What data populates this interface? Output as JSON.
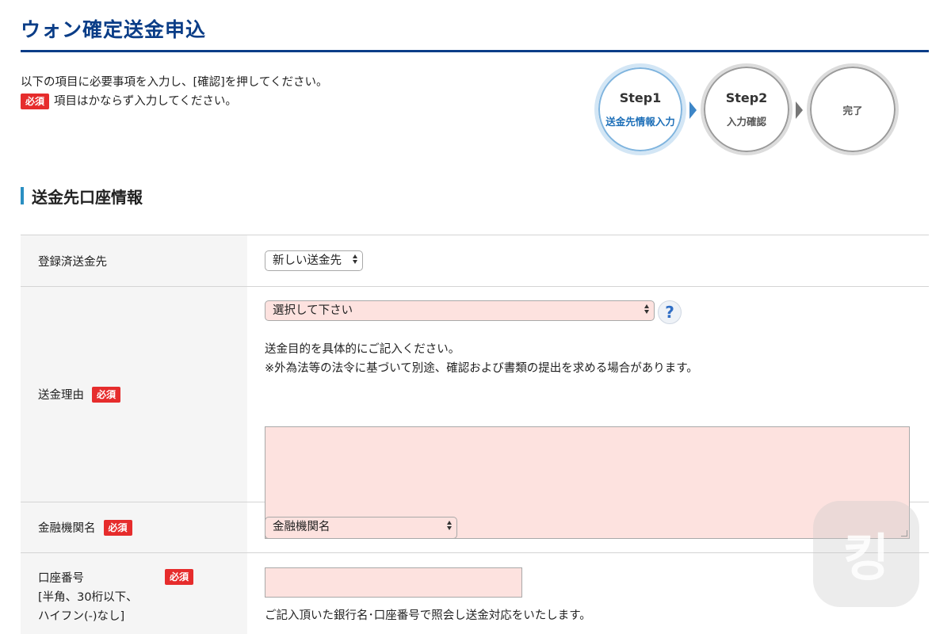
{
  "page": {
    "title": "ウォン確定送金申込"
  },
  "intro": {
    "line1": "以下の項目に必要事項を入力し、[確認]を押してください。",
    "line2": "項目はかならず入力してください。",
    "required_badge": "必須"
  },
  "steps": [
    {
      "num": "Step1",
      "label": "送金先情報入力",
      "active": true
    },
    {
      "num": "Step2",
      "label": "入力確認",
      "active": false
    },
    {
      "num": "",
      "label": "完了",
      "active": false
    }
  ],
  "section": {
    "heading": "送金先口座情報"
  },
  "form": {
    "registered": {
      "label": "登録済送金先",
      "select_value": "新しい送金先"
    },
    "reason": {
      "label": "送金理由",
      "required": "必須",
      "select_value": "選択して下さい",
      "help": "?",
      "note1": "送金目的を具体的にご記入ください。",
      "note2": "※外為法等の法令に基づいて別途、確認および書類の提出を求める場合があります。",
      "textarea_value": ""
    },
    "bank": {
      "label": "金融機関名",
      "required": "必須",
      "select_value": "金融機関名"
    },
    "account": {
      "label_line1": "口座番号",
      "label_line2": "[半角、30桁以下、",
      "label_line3": "ハイフン(-)なし]",
      "required": "必須",
      "input_value": "",
      "note": "ご記入頂いた銀行名･口座番号で照会し送金対応をいたします。"
    }
  },
  "watermark": {
    "glyph": "킹"
  },
  "colors": {
    "title": "#0a3d87",
    "required_badge": "#e62c2c",
    "input_pink": "#fde2df",
    "section_bar": "#2a8fc2",
    "active_step": "#1d6fb8"
  }
}
